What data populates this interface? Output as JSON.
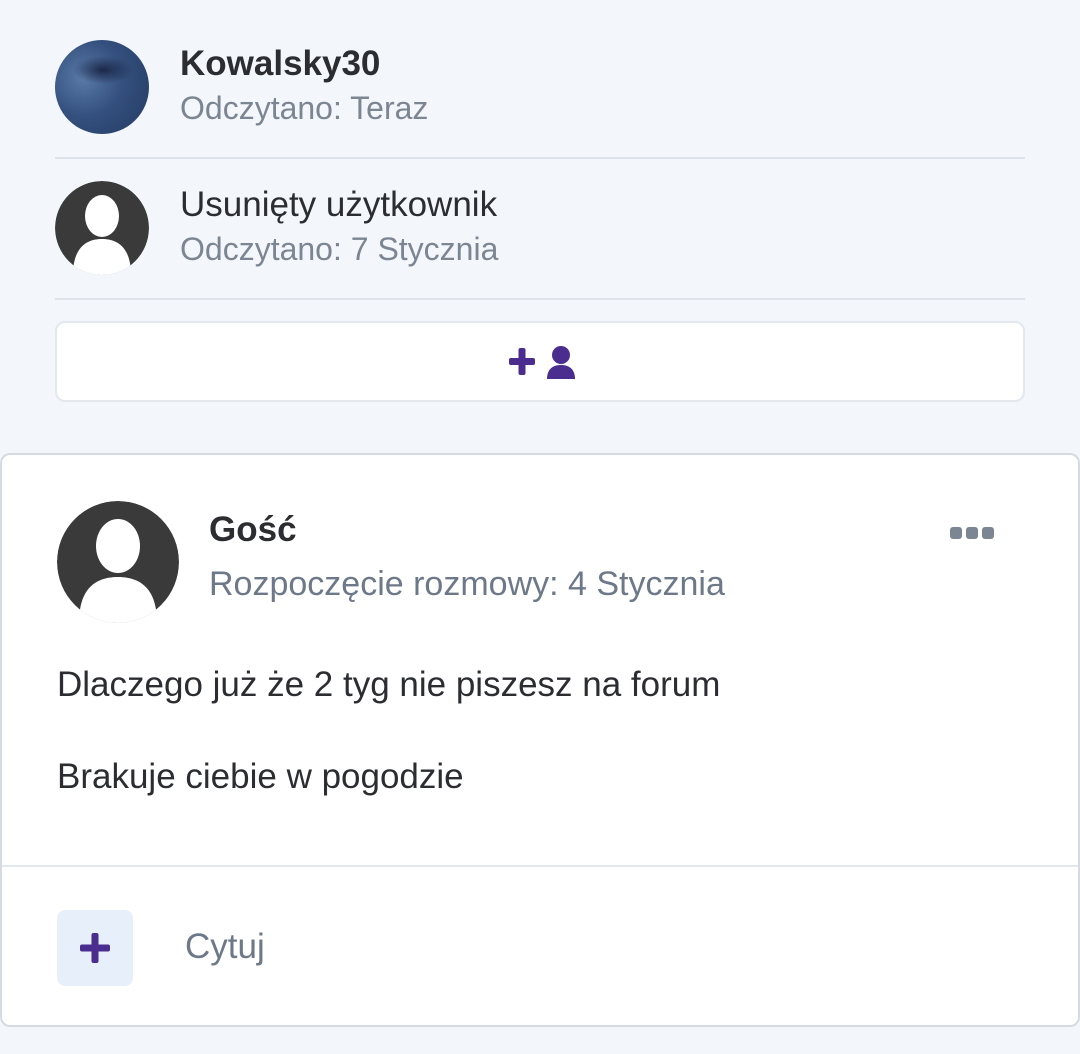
{
  "participants": [
    {
      "name": "Kowalsky30",
      "read": "Odczytano: Teraz",
      "avatar_icon": "user-photo-avatar"
    },
    {
      "name": "Usunięty użytkownik",
      "read": "Odczytano: 7 Stycznia",
      "avatar_icon": "default-user-avatar"
    }
  ],
  "add_participant": {
    "icon": "user-plus-icon",
    "accent": "#4b2d8f"
  },
  "message": {
    "author": "Gość",
    "started": "Rozpoczęcie rozmowy: 4 Stycznia",
    "lines": [
      "Dlaczego już że 2 tyg nie piszesz na forum",
      "Brakuje ciebie w pogodzie"
    ],
    "more_icon": "more-dots-icon"
  },
  "actions": {
    "quote_label": "Cytuj",
    "quote_icon": "plus-icon"
  },
  "colors": {
    "accent": "#4b2d8f",
    "muted": "#7c8693",
    "background": "#f3f6fa"
  }
}
